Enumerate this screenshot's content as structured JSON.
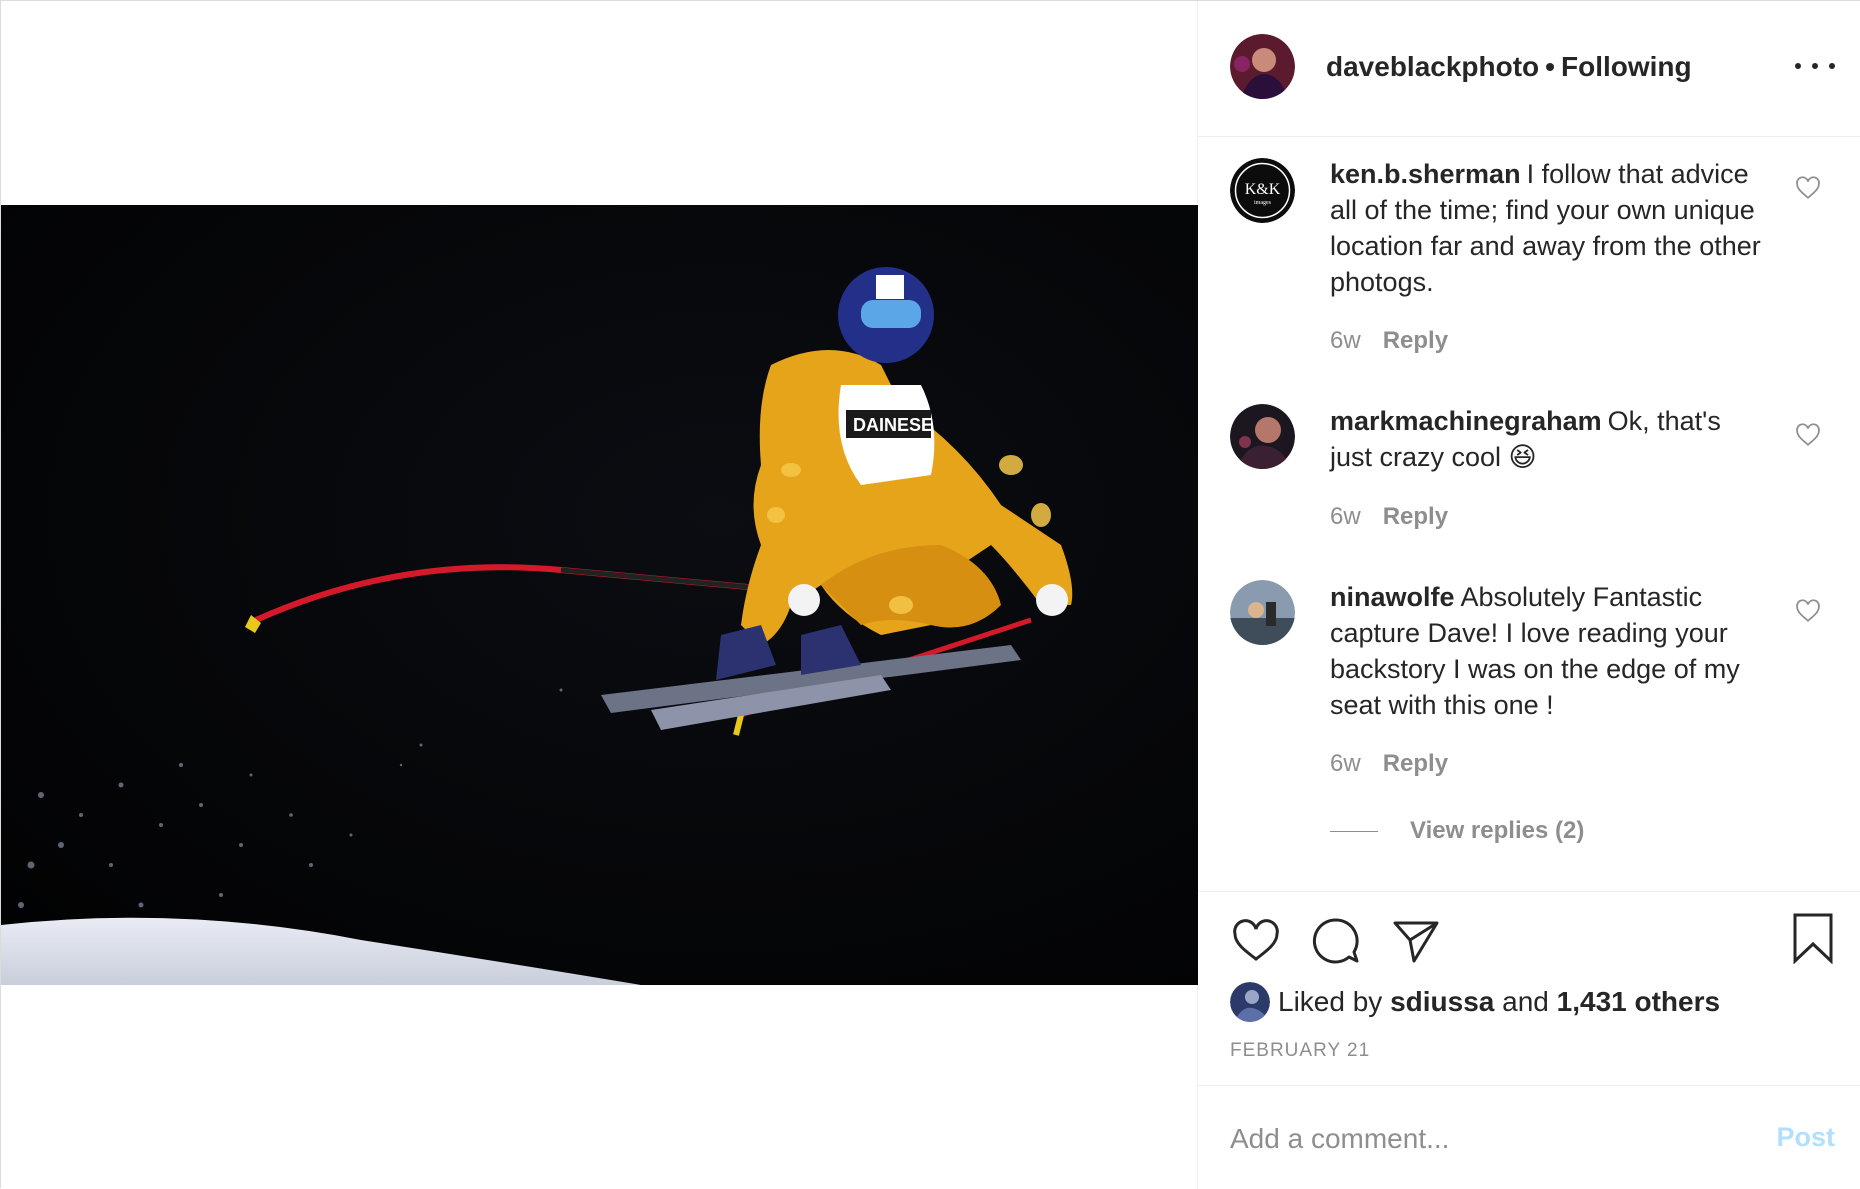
{
  "header": {
    "username": "daveblackphoto",
    "separator": "•",
    "follow_status": "Following",
    "more_icon": "more-horizontal-icon"
  },
  "comments": [
    {
      "username": "ken.b.sherman",
      "text": "I follow that advice all of the time; find your own unique location far and away from the other photogs.",
      "age": "6w",
      "reply_label": "Reply",
      "avatar_text": "K&K"
    },
    {
      "username": "markmachinegraham",
      "text": "Ok, that's just crazy cool 😆",
      "age": "6w",
      "reply_label": "Reply"
    },
    {
      "username": "ninawolfe",
      "text": "Absolutely Fantastic capture Dave! I love reading your backstory I was on the edge of my seat with this one !",
      "age": "6w",
      "reply_label": "Reply",
      "view_replies": "View replies (2)"
    }
  ],
  "actions": {
    "like_icon": "heart-icon",
    "comment_icon": "comment-bubble-icon",
    "share_icon": "paper-plane-icon",
    "save_icon": "bookmark-icon"
  },
  "likes": {
    "prefix": "Liked by",
    "user": "sdiussa",
    "conjunction": "and",
    "others": "1,431 others"
  },
  "date": "FEBRUARY 21",
  "add_comment": {
    "placeholder": "Add a comment...",
    "post_label": "Post"
  },
  "colors": {
    "text": "#262626",
    "secondary": "#8e8e8e",
    "post_button": "#b2dffc",
    "border": "#efefef"
  }
}
